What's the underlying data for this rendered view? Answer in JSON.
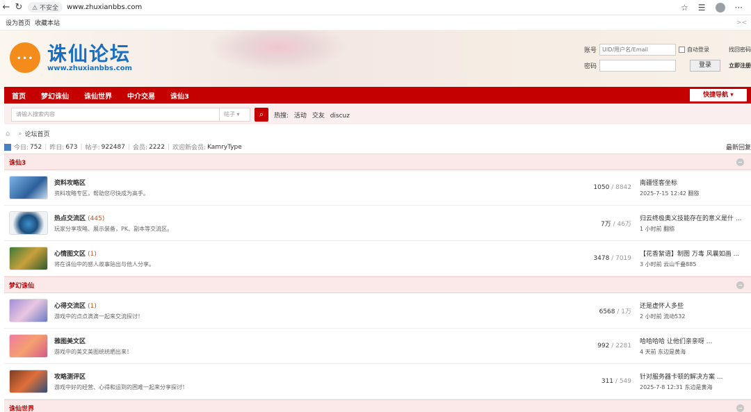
{
  "browser": {
    "secure_label": "不安全",
    "url": "www.zhuxianbbs.com"
  },
  "toplinks": {
    "set_home": "设为首页",
    "bookmark": "收藏本站",
    "close": "><"
  },
  "logo": {
    "title": "诛仙论坛",
    "url_text": "www.zhuxianbbs.com"
  },
  "login": {
    "account_label": "账号",
    "account_placeholder": "UID/用户名/Email",
    "auto_login": "自动登录",
    "recover": "找回密码",
    "password_label": "密码",
    "login_button": "登录",
    "register": "立即注册"
  },
  "nav": {
    "items": [
      "首页",
      "梦幻诛仙",
      "诛仙世界",
      "中介交易",
      "诛仙3"
    ],
    "quick": "快捷导航 ▾"
  },
  "search": {
    "placeholder": "请输入搜索内容",
    "type": "帖子 ▾",
    "hot_label": "热搜:",
    "hot": [
      "活动",
      "交友",
      "discuz"
    ]
  },
  "breadcrumb": {
    "sep": "»",
    "current": "论坛首页"
  },
  "stats": {
    "today_label": "今日:",
    "today": "752",
    "yesterday_label": "昨日:",
    "yesterday": "673",
    "posts_label": "帖子:",
    "posts": "922487",
    "members_label": "会员:",
    "members": "2222",
    "welcome_label": "欢迎新会员:",
    "newest": "KamryType",
    "latest_reply": "最新回复"
  },
  "categories": [
    {
      "name": "诛仙3",
      "forums": [
        {
          "name": "资料攻略区",
          "count": "",
          "desc": "资料攻略专区，帮助您尽快成为高手。",
          "topics": "1050",
          "posts": "8842",
          "last_title": "南疆怪客坐标",
          "last_meta": "2025-7-15 12:42 翻猕",
          "thumb": "t1"
        },
        {
          "name": "热点交流区",
          "count": "(445)",
          "desc": "玩家分享攻略、展示装备，PK、副本等交流区。",
          "topics": "7万",
          "posts": "46万",
          "last_title": "归云终极奥义技能存在的意义是什 ...",
          "last_meta": "1 小时前 翻猕",
          "thumb": "t2"
        },
        {
          "name": "心情图文区",
          "count": "(1)",
          "desc": "将在诛仙中的感人故事贴出与他人分享。",
          "topics": "3478",
          "posts": "7019",
          "last_title": "【花香絮语】制图 万毒 风曩如画 ...",
          "last_meta": "3 小时前 云山千叠885",
          "thumb": "t3"
        }
      ]
    },
    {
      "name": "梦幻诛仙",
      "forums": [
        {
          "name": "心得交流区",
          "count": "(1)",
          "desc": "游戏中的点点滴滴一起来交流探讨！",
          "topics": "6568",
          "posts": "1万",
          "last_title": "还是虚怀人多些",
          "last_meta": "2 小时前 流动532",
          "thumb": "t4"
        },
        {
          "name": "雅图美文区",
          "count": "",
          "desc": "游戏中的美文美图统统晒出来！",
          "topics": "992",
          "posts": "2281",
          "last_title": "哈哈哈哈 让他们亲亲呀 ...",
          "last_meta": "4 天前 东边是黄海",
          "thumb": "t5"
        },
        {
          "name": "攻略测评区",
          "count": "",
          "desc": "游戏中好的经营、心得和运到的困难一起来分享探讨！",
          "topics": "311",
          "posts": "549",
          "last_title": "针对服务器卡顿的解决方案 ...",
          "last_meta": "2025-7-8 12:31 东边是黄海",
          "thumb": "t6"
        }
      ]
    },
    {
      "name": "诛仙世界",
      "forums": []
    }
  ]
}
